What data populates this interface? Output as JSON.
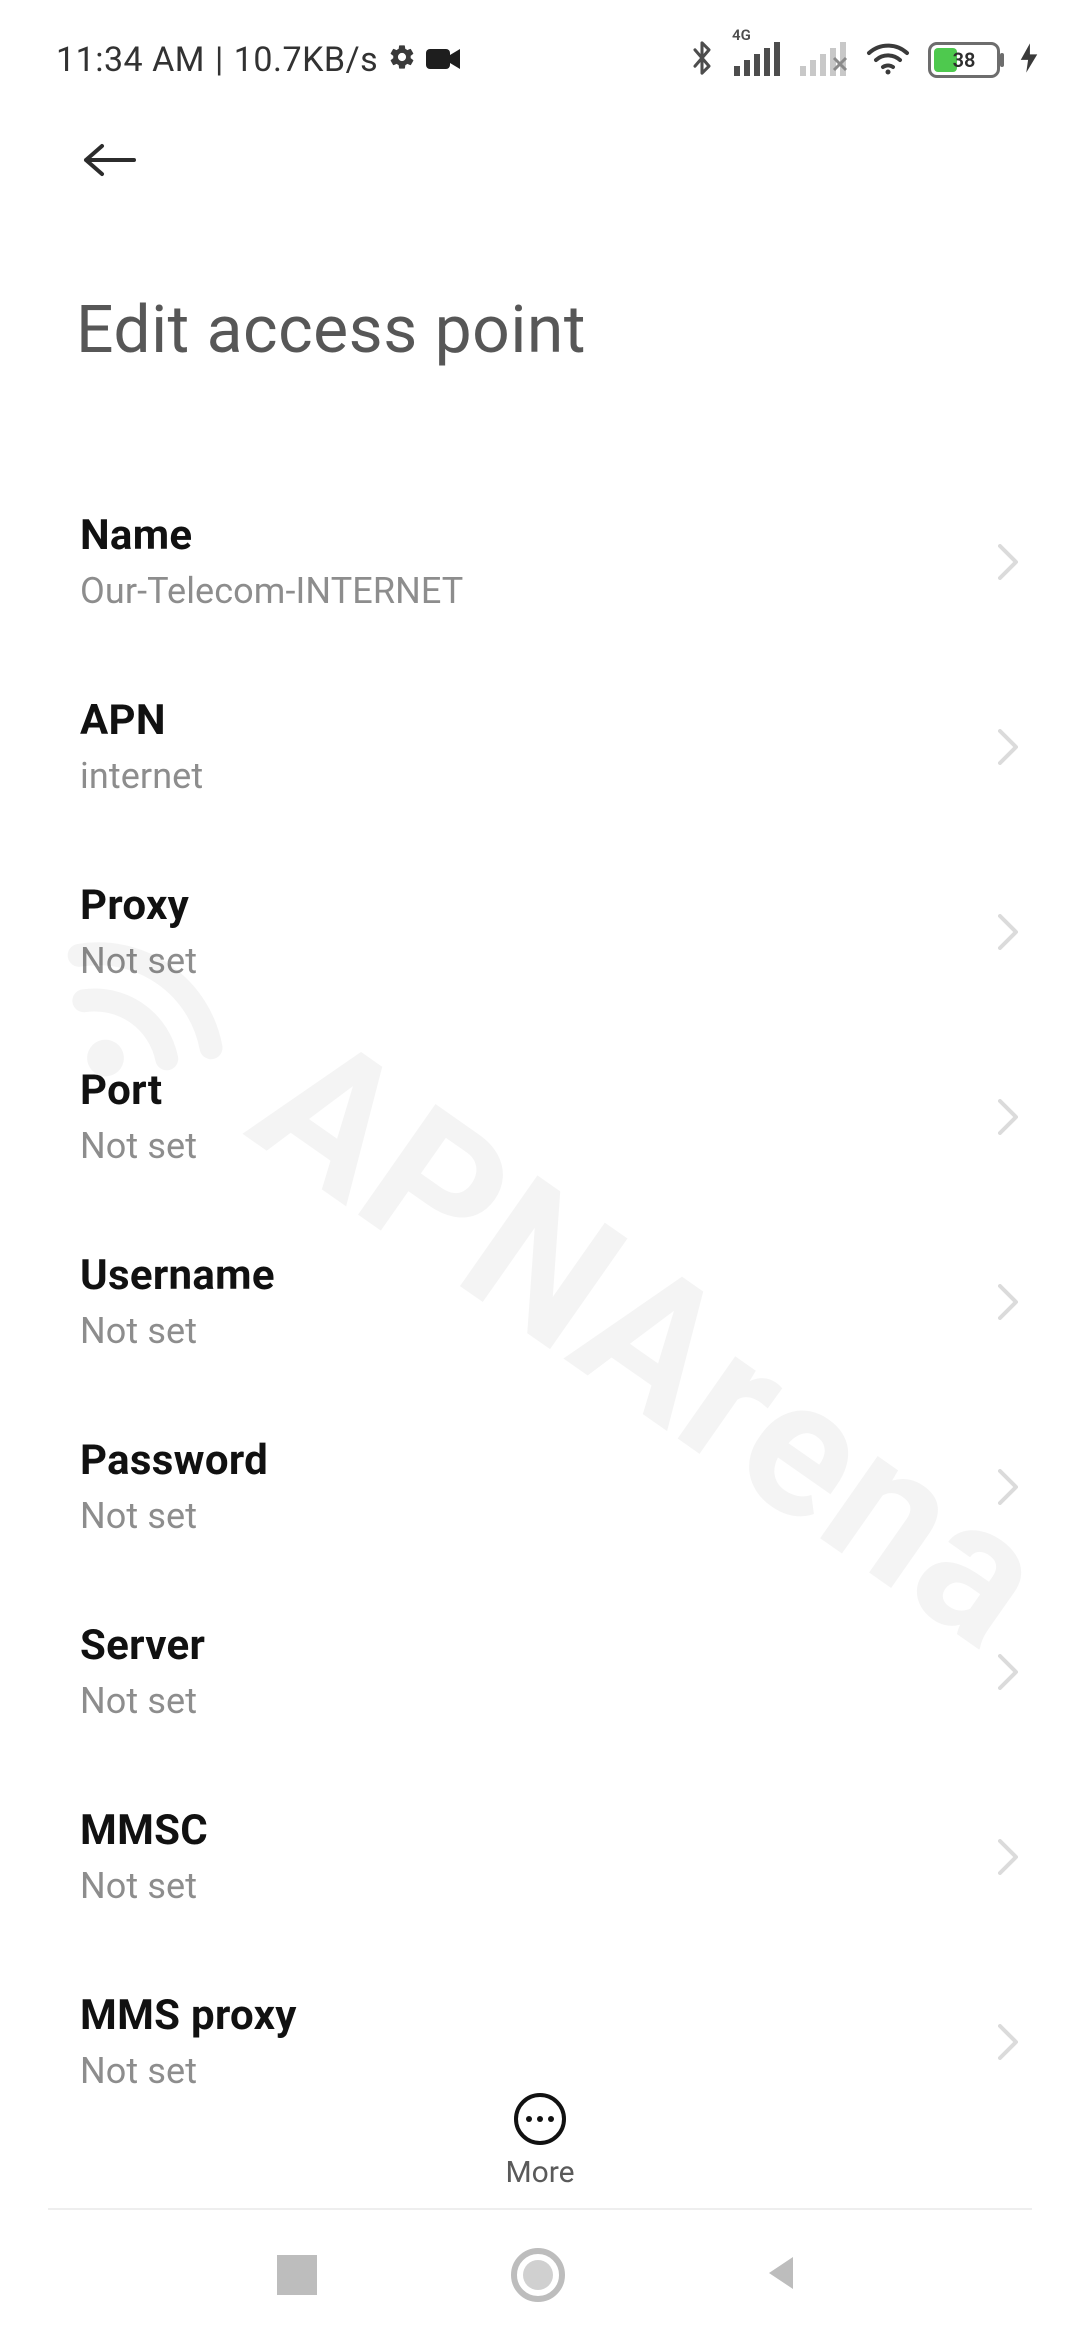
{
  "status_bar": {
    "time": "11:34 AM",
    "sep": " | ",
    "net_speed": "10.7KB/s",
    "sim1_net": "4G",
    "battery_pct": "38",
    "battery_fill_pct": 38
  },
  "page": {
    "title": "Edit access point"
  },
  "rows": [
    {
      "id": "name",
      "title": "Name",
      "value": "Our-Telecom-INTERNET"
    },
    {
      "id": "apn",
      "title": "APN",
      "value": "internet"
    },
    {
      "id": "proxy",
      "title": "Proxy",
      "value": "Not set"
    },
    {
      "id": "port",
      "title": "Port",
      "value": "Not set"
    },
    {
      "id": "username",
      "title": "Username",
      "value": "Not set"
    },
    {
      "id": "password",
      "title": "Password",
      "value": "Not set"
    },
    {
      "id": "server",
      "title": "Server",
      "value": "Not set"
    },
    {
      "id": "mmsc",
      "title": "MMSC",
      "value": "Not set"
    },
    {
      "id": "mms_proxy",
      "title": "MMS proxy",
      "value": "Not set"
    }
  ],
  "quick_actions": {
    "more_label": "More"
  },
  "watermark": {
    "text": "APNArena"
  }
}
